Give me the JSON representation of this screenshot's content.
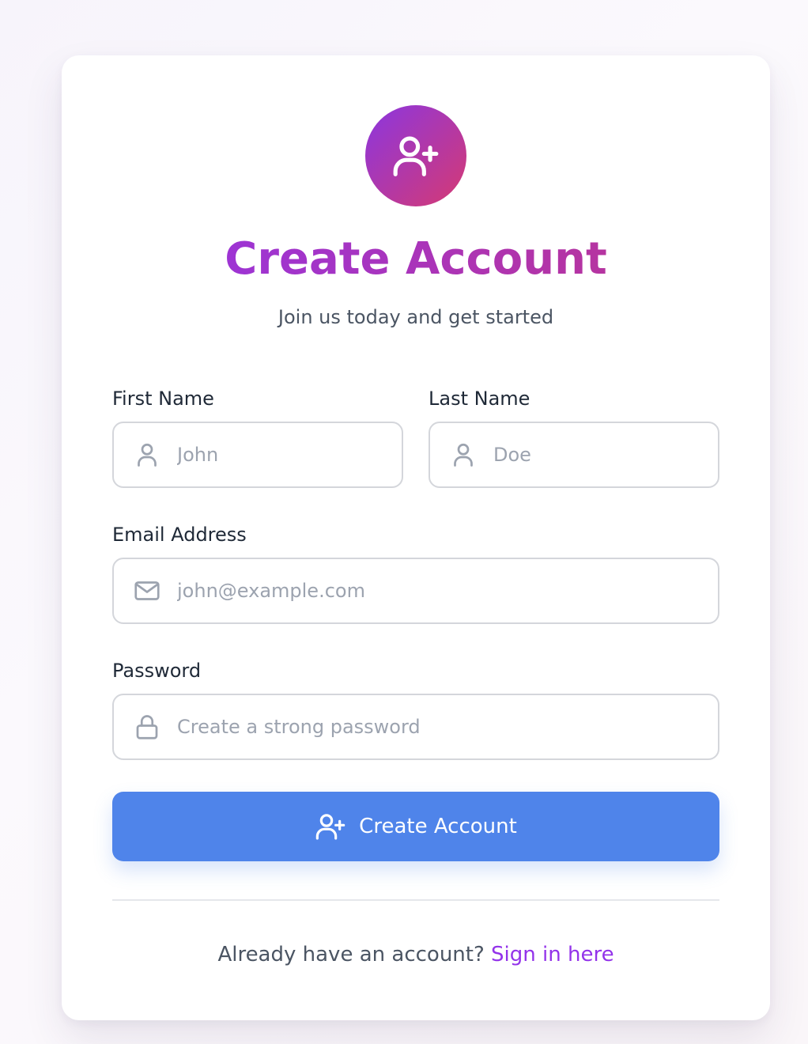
{
  "header": {
    "avatar_icon": "user-plus-icon",
    "title": "Create Account",
    "subtitle": "Join us today and get started"
  },
  "form": {
    "first_name": {
      "label": "First Name",
      "placeholder": "John",
      "value": "",
      "icon": "user-icon"
    },
    "last_name": {
      "label": "Last Name",
      "placeholder": "Doe",
      "value": "",
      "icon": "user-icon"
    },
    "email": {
      "label": "Email Address",
      "placeholder": "john@example.com",
      "value": "",
      "icon": "mail-icon"
    },
    "password": {
      "label": "Password",
      "placeholder": "Create a strong password",
      "value": "",
      "icon": "lock-icon"
    },
    "submit": {
      "label": "Create Account",
      "icon": "user-plus-icon"
    }
  },
  "footer": {
    "prompt": "Already have an account?",
    "link_label": "Sign in here"
  },
  "colors": {
    "title_gradient_start": "#9333ea",
    "title_gradient_end": "#c0358a",
    "button": "#4f84ea",
    "link": "#9333ea",
    "input_border": "#d4d6db",
    "placeholder": "#9ca3af"
  }
}
